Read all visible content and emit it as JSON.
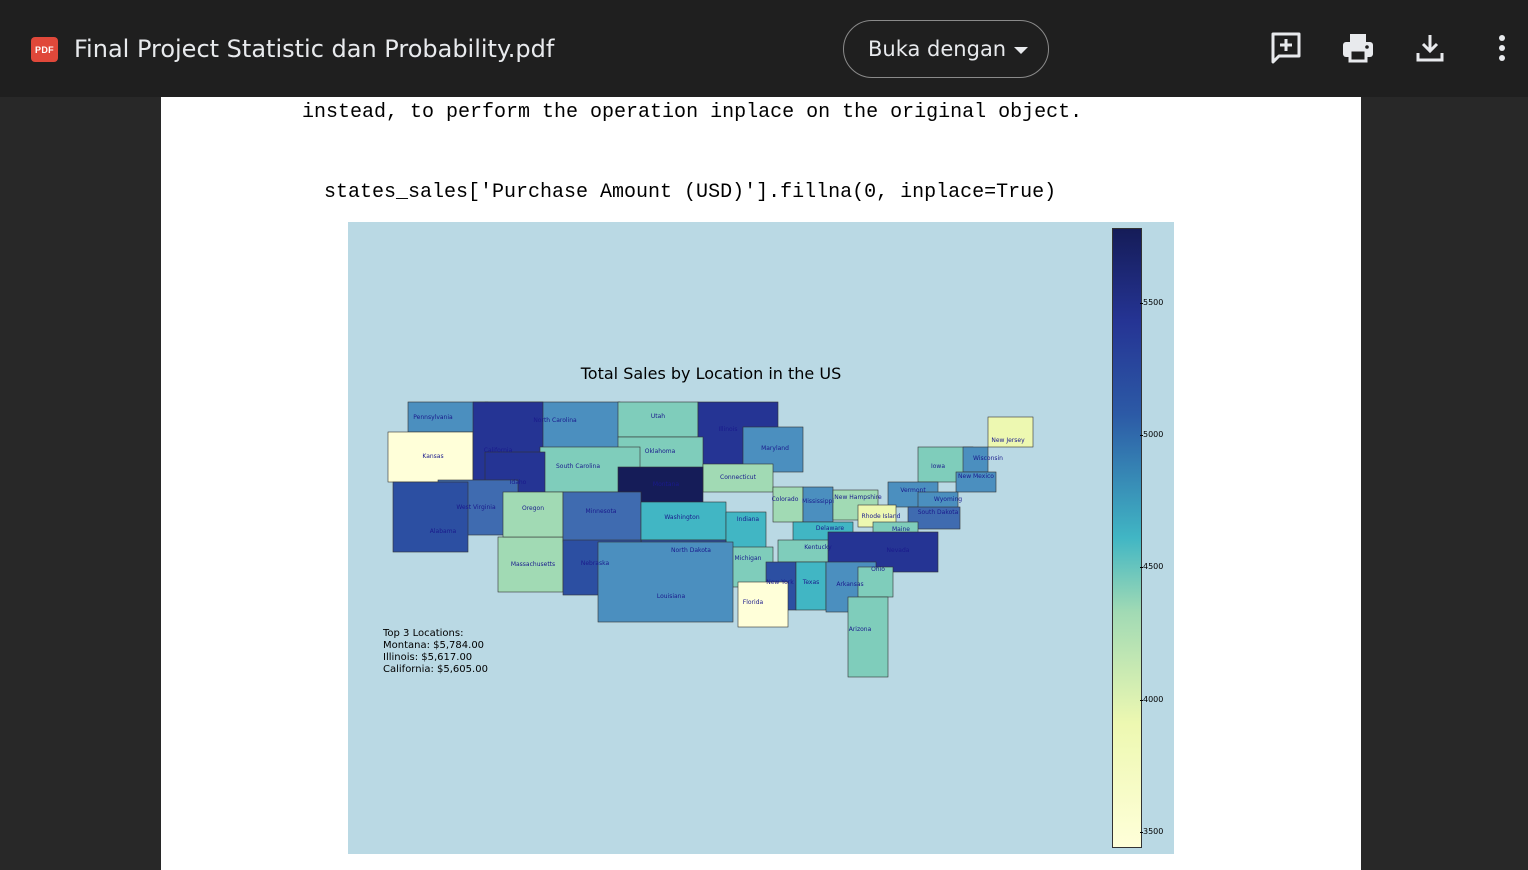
{
  "header": {
    "pdf_badge": "PDF",
    "title": "Final Project Statistic dan Probability.pdf",
    "open_with": "Buka dengan"
  },
  "icons": [
    "pdf-icon",
    "add-comment-icon",
    "print-icon",
    "download-icon",
    "more-vert-icon",
    "chevron-down-icon"
  ],
  "colors": {
    "topbar": "#1f1f1f",
    "background": "#282828",
    "page": "#ffffff",
    "pdf_badge": "#e0483a"
  },
  "document": {
    "code_line1": "instead, to perform the operation inplace on the original object.",
    "code_line2": "states_sales['Purchase Amount (USD)'].fillna(0, inplace=True)"
  },
  "chart_data": {
    "type": "choropleth",
    "title": "Total Sales by Location in the US",
    "colormap": "YlGnBu",
    "colorbar_ticks": [
      "3500",
      "4000",
      "4500",
      "5000",
      "5500"
    ],
    "colorbar_range": [
      3480,
      5784
    ],
    "annotation": {
      "heading": "Top 3 Locations:",
      "lines": [
        "Montana: $5,784.00",
        "Illinois: $5,617.00",
        "California: $5,605.00"
      ]
    },
    "state_labels": [
      "Pennsylvania",
      "North Carolina",
      "Utah",
      "Illinois",
      "Kansas",
      "California",
      "Oklahoma",
      "Maryland",
      "South Carolina",
      "Idaho",
      "New Jersey",
      "Iowa",
      "Vermont",
      "Wisconsin",
      "Connecticut",
      "Montana",
      "New Mexico",
      "Massachusetts",
      "Colorado",
      "Mississippi",
      "New Hampshire",
      "West Virginia",
      "Oregon",
      "Minnesota",
      "Washington",
      "Indiana",
      "Rhode Island",
      "Wyoming",
      "South Dakota",
      "Alabama",
      "Delaware",
      "Maine",
      "North Dakota",
      "Kentucky",
      "Nevada",
      "Nebraska",
      "Michigan",
      "New York",
      "Texas",
      "Arkansas",
      "Ohio",
      "Louisiana",
      "Florida",
      "Arizona"
    ]
  }
}
